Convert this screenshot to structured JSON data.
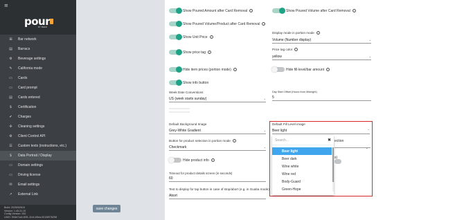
{
  "sidebar": {
    "menu_icon": "≡",
    "logo_text": "pour",
    "logo_by": "BY BEER",
    "items": [
      {
        "label": "Bar network",
        "icon": "network-icon",
        "glyph": "⊞"
      },
      {
        "label": "Barracs",
        "icon": "barracs-icon",
        "glyph": "▤"
      },
      {
        "label": "Beverage settings",
        "icon": "beverage-icon",
        "glyph": "⚙"
      },
      {
        "label": "California mode",
        "icon": "wrench-icon",
        "glyph": "✎"
      },
      {
        "label": "Cards",
        "icon": "card-icon",
        "glyph": "▭"
      },
      {
        "label": "Card prompt",
        "icon": "prompt-icon",
        "glyph": "▭"
      },
      {
        "label": "Cards entered",
        "icon": "cards-entered-icon",
        "glyph": "▤"
      },
      {
        "label": "Certification",
        "icon": "certification-icon",
        "glyph": "$"
      },
      {
        "label": "Charges",
        "icon": "charges-icon",
        "glyph": "✔"
      },
      {
        "label": "Cleaning settings",
        "icon": "cleaning-icon",
        "glyph": "✣"
      },
      {
        "label": "Client Control API",
        "icon": "api-icon",
        "glyph": "⚙"
      },
      {
        "label": "Custom texts (instructions, etc.)",
        "icon": "custom-texts-icon",
        "glyph": "☰"
      },
      {
        "label": "Data Portrait / Display",
        "icon": "data-display-icon",
        "glyph": "$"
      },
      {
        "label": "Domain settings",
        "icon": "domain-icon",
        "glyph": "▭"
      },
      {
        "label": "Driving license",
        "icon": "license-icon",
        "glyph": "▭"
      },
      {
        "label": "Email settings",
        "icon": "email-icon",
        "glyph": "✉"
      },
      {
        "label": "External Link",
        "icon": "external-link-icon",
        "glyph": "↗"
      }
    ],
    "active_index": 12,
    "footer": {
      "build": "Build: 2025092610",
      "version": "Version: 1.45.21.19",
      "config": "Config Version: 252",
      "uuid": "UUID: 90de7ca4-60f1-11e4-b5ea-00108976258"
    }
  },
  "settings": {
    "poured_amount_label": "Show Poured Amount after Card Removal",
    "poured_volume_label": "Show Poured Volume after Card Removal",
    "poured_volume_product_label": "Show Poured Volume/Product after Card Removal",
    "unit_price_label": "Show Unit Price",
    "display_mode_label": "Display mode in portion mode",
    "display_mode_value": "Volume (Number display)",
    "price_tag_label": "Show price tag",
    "price_tag_color_label": "Price tag color",
    "price_tag_color_value": "yellow",
    "hide_prices_label": "Hide item prices (portion mode)",
    "hide_fill_label": "Hide fill-level/bar amount",
    "info_button_label": "Show info button",
    "week_date_label": "Week Date Conventions",
    "week_date_value": "US (week starts sunday)",
    "day_start_label": "Day Start Offset (Hours from Midnight)",
    "day_start_value": "5",
    "bg_image_label": "Default Background Image",
    "bg_image_value": "Grey-White Gradient",
    "fill_image_label": "Default Fill Level image",
    "fill_image_value": "Beer light",
    "product_selection_label": "Button for product selection in portion mode",
    "product_selection_value": "Checkmark",
    "hide_product_info_label": "Hide product info",
    "timeout_label": "Timeout for product details screen (in seconds)",
    "timeout_value": "60",
    "tap_text_label": "Text to display for tap button in case of stop/abort (e.g. in Guaba mode)",
    "tap_text_value": "Abort",
    "save_label": "save changes",
    "behind_selection": "ection",
    "behind_s": "s)"
  },
  "dropdown": {
    "search_placeholder": "Search...",
    "close_glyph": "✖",
    "options": [
      "Beer light",
      "Beer dark",
      "Wine white",
      "Wine red",
      "Body-Guard",
      "Green-Hope"
    ],
    "selected_index": 0
  },
  "colors": {
    "toggle_on": "#1fa386",
    "highlight": "#d9262b",
    "selected_option": "#3fa6ee",
    "sidebar_bg": "#3c3f43"
  }
}
